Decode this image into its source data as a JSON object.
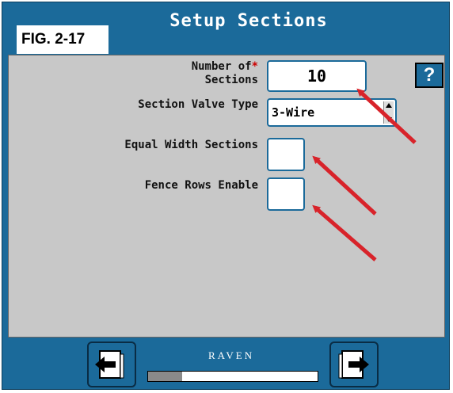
{
  "figure_label": "FIG. 2-17",
  "title": "Setup Sections",
  "fields": {
    "number_of_sections": {
      "label_line1": "Number of",
      "label_line2": "Sections",
      "required_mark": "*",
      "value": "10"
    },
    "section_valve_type": {
      "label": "Section Valve Type",
      "value": "3-Wire"
    },
    "equal_width_sections": {
      "label": "Equal Width Sections",
      "checked": false
    },
    "fence_rows_enable": {
      "label": "Fence Rows Enable",
      "checked": false
    }
  },
  "help": {
    "label": "?"
  },
  "brand": {
    "text": "RAVEN"
  },
  "progress": {
    "fraction": 0.2
  },
  "colors": {
    "primary": "#1b6a9a",
    "panel": "#c8c8c8",
    "arrow": "#d8232a",
    "required": "#cc0000"
  },
  "icons": {
    "back": "exit-left-icon",
    "next": "exit-right-icon"
  }
}
